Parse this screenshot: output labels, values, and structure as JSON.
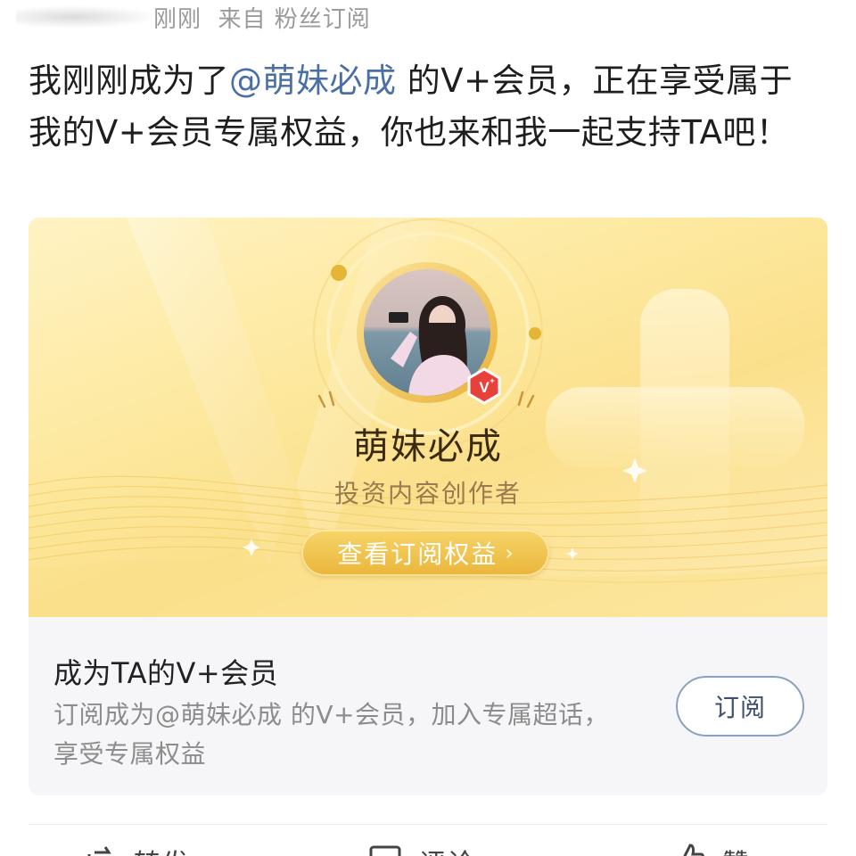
{
  "post_meta": {
    "time": "刚刚",
    "source": "来自 粉丝订阅"
  },
  "post": {
    "prefix": "我刚刚成为了",
    "mention": "@萌妹必成",
    "suffix": " 的V+会员，正在享受属于我的V+会员专属权益，你也来和我一起支持TA吧！"
  },
  "card": {
    "creator_name": "萌妹必成",
    "creator_title": "投资内容创作者",
    "view_button": "查看订阅权益",
    "badge_icon": "vplus-badge-icon",
    "info_title": "成为TA的V+会员",
    "info_desc": "订阅成为@萌妹必成 的V+会员，加入专属超话，享受专属权益",
    "subscribe_button": "订阅"
  },
  "actions": [
    {
      "label": "转发",
      "icon": "repost-icon"
    },
    {
      "label": "评论",
      "icon": "comment-icon"
    },
    {
      "label": "赞",
      "icon": "like-icon"
    }
  ],
  "colors": {
    "mention": "#4a6fa5",
    "gold": "#eab63a",
    "badge": "#e8403a"
  }
}
